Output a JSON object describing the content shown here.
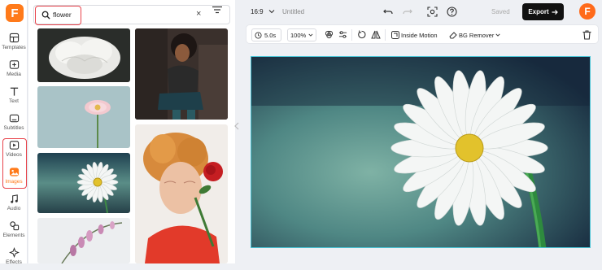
{
  "brand": {
    "logo_letter": "F",
    "accent": "#ff7a1a"
  },
  "sidebar": {
    "items": [
      {
        "label": "Templates",
        "icon": "templates-icon"
      },
      {
        "label": "Media",
        "icon": "media-icon"
      },
      {
        "label": "Text",
        "icon": "text-icon"
      },
      {
        "label": "Subtitles",
        "icon": "subtitles-icon"
      },
      {
        "label": "Videos",
        "icon": "videos-icon"
      },
      {
        "label": "Images",
        "icon": "images-icon",
        "active": true
      },
      {
        "label": "Audio",
        "icon": "audio-icon"
      },
      {
        "label": "Elements",
        "icon": "elements-icon"
      },
      {
        "label": "Effects",
        "icon": "effects-icon"
      }
    ]
  },
  "search": {
    "value": "flower",
    "clear_icon": "×"
  },
  "header": {
    "aspect_ratio": "16:9",
    "project_title": "Untitled",
    "saved_label": "Saved",
    "export_label": "Export",
    "avatar_letter": "F"
  },
  "toolbar": {
    "duration": "5.0s",
    "zoom": "100%",
    "inside_motion": "Inside Motion",
    "bg_remover": "BG Remover"
  },
  "colors": {
    "highlight": "#e8434b",
    "selection": "#49c4d6",
    "export_bg": "#111111"
  }
}
